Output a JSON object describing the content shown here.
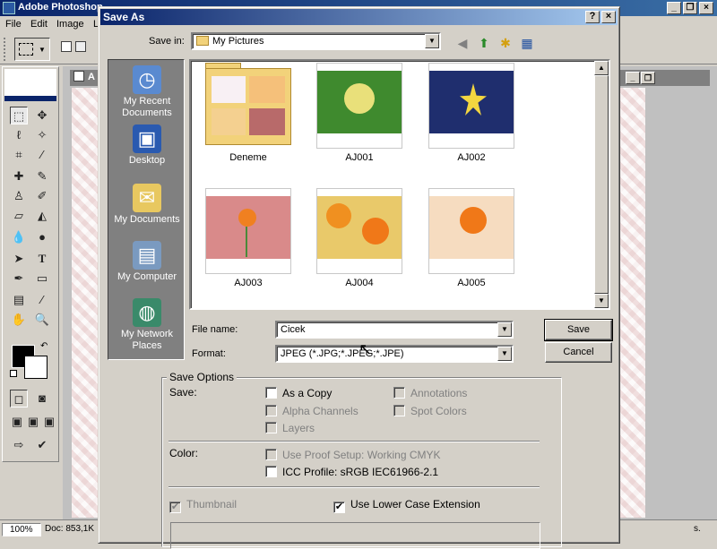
{
  "app": {
    "title": "Adobe Photoshop",
    "menus": [
      "File",
      "Edit",
      "Image",
      "L"
    ],
    "zoom": "100%",
    "doc_info": "Doc: 853,1K",
    "doc_window_label": "A",
    "status_right": "s."
  },
  "dialog": {
    "title": "Save As",
    "save_in_label": "Save in:",
    "save_in_value": "My Pictures",
    "places": [
      {
        "label": "My Recent Documents",
        "icon": "recent-documents-icon"
      },
      {
        "label": "Desktop",
        "icon": "desktop-icon"
      },
      {
        "label": "My Documents",
        "icon": "my-documents-icon"
      },
      {
        "label": "My Computer",
        "icon": "my-computer-icon"
      },
      {
        "label": "My Network Places",
        "icon": "network-places-icon"
      }
    ],
    "files": [
      {
        "name": "Deneme",
        "type": "folder"
      },
      {
        "name": "AJ001",
        "type": "image",
        "color": "#3f8a2e"
      },
      {
        "name": "AJ002",
        "type": "image",
        "color": "#1f2e6e"
      },
      {
        "name": "AJ003",
        "type": "image",
        "color": "#d98a8a"
      },
      {
        "name": "AJ004",
        "type": "image",
        "color": "#e9c96a"
      },
      {
        "name": "AJ005",
        "type": "image",
        "color": "#f6dcc0"
      }
    ],
    "file_name_label": "File name:",
    "file_name_value": "Cicek",
    "format_label": "Format:",
    "format_value": "JPEG (*.JPG;*.JPEG;*.JPE)",
    "save_button": "Save",
    "cancel_button": "Cancel",
    "save_options": {
      "legend": "Save Options",
      "save_label": "Save:",
      "as_a_copy": "As a Copy",
      "alpha_channels": "Alpha Channels",
      "layers": "Layers",
      "annotations": "Annotations",
      "spot_colors": "Spot Colors",
      "color_label": "Color:",
      "use_proof_setup": "Use Proof Setup:  Working CMYK",
      "icc_profile": "ICC Profile:  sRGB IEC61966-2.1",
      "thumbnail": "Thumbnail",
      "lower_case_extension": "Use Lower Case Extension"
    }
  }
}
